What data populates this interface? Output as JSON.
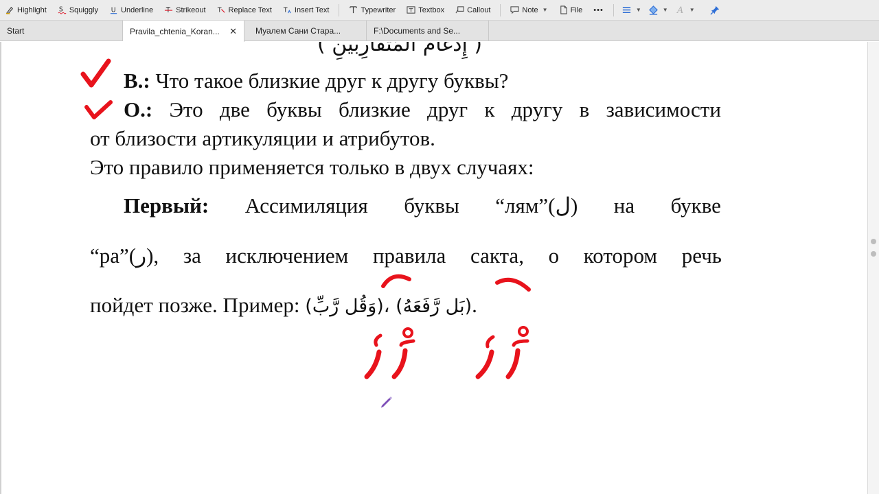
{
  "toolbar": {
    "highlight": "Highlight",
    "squiggly": "Squiggly",
    "underline": "Underline",
    "strikeout": "Strikeout",
    "replace_text": "Replace Text",
    "insert_text": "Insert Text",
    "typewriter": "Typewriter",
    "textbox": "Textbox",
    "callout": "Callout",
    "note": "Note",
    "file": "File",
    "more": "•••"
  },
  "tabs": [
    {
      "label": "Start"
    },
    {
      "label": "Pravila_chtenia_Koran..."
    },
    {
      "label": "Муалем Сани Стара..."
    },
    {
      "label": "F:\\Documents and Se..."
    }
  ],
  "document": {
    "top_arabic": "( إِدْغَامُ الْمُتَقَارِبَيْنِ )",
    "q_label": "В.:",
    "q_text": " Что такое близкие друг к другу буквы?",
    "a_label": "О.:",
    "a_words": [
      "Это",
      "две",
      "буквы",
      "близкие",
      "друг",
      "к",
      "другу",
      "в",
      "зависимости"
    ],
    "line2": "от близости артикуляции и атрибутов.",
    "line3": "Это правило применяется только в двух случаях:",
    "first_label": "Первый:",
    "p1_words": [
      "Ассимиляция",
      "буквы",
      "“лям”(ل)",
      "на",
      "букве"
    ],
    "p2_words": [
      "“ра”(ر),",
      "за",
      "исключением",
      "правила",
      "сакта,",
      "о",
      "котором",
      "речь"
    ],
    "p3_start": "пойдет позже. Пример: ",
    "example1": "(وَقُل رَّبِّ)",
    "comma": "، ",
    "example2": "(بَل رَّفَعَهُ)",
    "p3_end": "."
  },
  "colors": {
    "ink_red": "#e8131c",
    "pen_purple": "#7e4fb8",
    "accent_blue": "#2f6fd6"
  }
}
